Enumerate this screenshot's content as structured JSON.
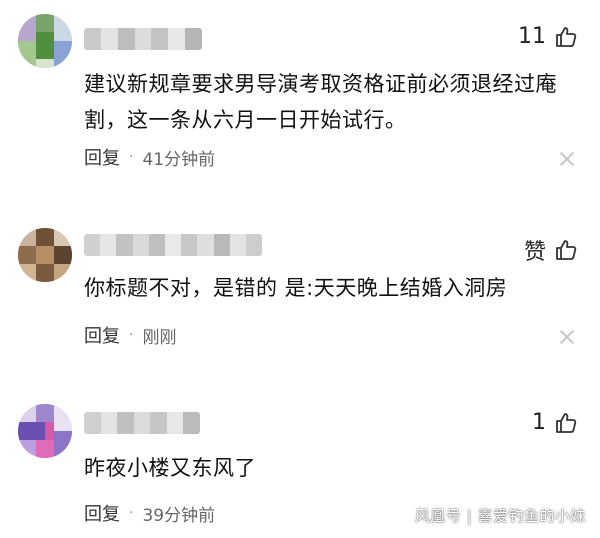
{
  "comments": [
    {
      "likes": "11",
      "text": "建议新规章要求男导演考取资格证前必须退经过庵割，这一条从六月一日开始试行。",
      "reply_label": "回复",
      "separator": "·",
      "time": "41分钟前"
    },
    {
      "likes": "赞",
      "text": "你标题不对，是错的 是:天天晚上结婚入洞房",
      "reply_label": "回复",
      "separator": "·",
      "time": "刚刚"
    },
    {
      "likes": "1",
      "text": "昨夜小楼又东风了",
      "reply_label": "回复",
      "separator": "·",
      "time": "39分钟前"
    }
  ],
  "watermark": "风凰号 | 喜爱钓鱼的小妹",
  "icons": {
    "like": "thumbs-up-icon",
    "close": "close-icon"
  },
  "colors": {
    "text": "#111111",
    "meta": "#666666",
    "close": "#c7c7c7"
  }
}
